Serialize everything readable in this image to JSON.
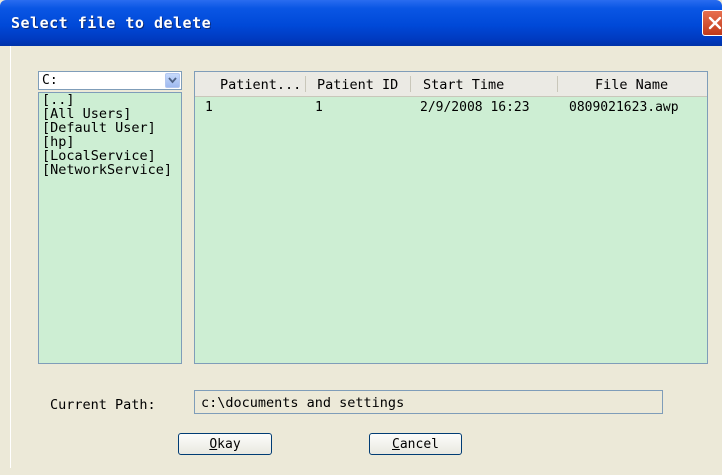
{
  "window": {
    "title": "Select file to delete"
  },
  "drive": {
    "selected": "C:"
  },
  "directories": [
    "[..]",
    "[All Users]",
    "[Default User]",
    "[hp]",
    "[LocalService]",
    "[NetworkService]"
  ],
  "table": {
    "columns": [
      "Patient...",
      "Patient ID",
      "Start Time",
      "File Name"
    ],
    "rows": [
      {
        "patient": "1",
        "patient_id": "1",
        "start_time": "2/9/2008 16:23",
        "file_name": "0809021623.awp"
      }
    ]
  },
  "path": {
    "label": "Current Path:",
    "value": "c:\\documents and settings"
  },
  "buttons": {
    "okay_key": "O",
    "okay_rest": "kay",
    "cancel_key": "C",
    "cancel_rest": "ancel"
  },
  "colors": {
    "title_bar": "#0a56e4",
    "list_bg": "#cdeed3",
    "dialog_bg": "#ece9d8",
    "close": "#d9532c"
  }
}
